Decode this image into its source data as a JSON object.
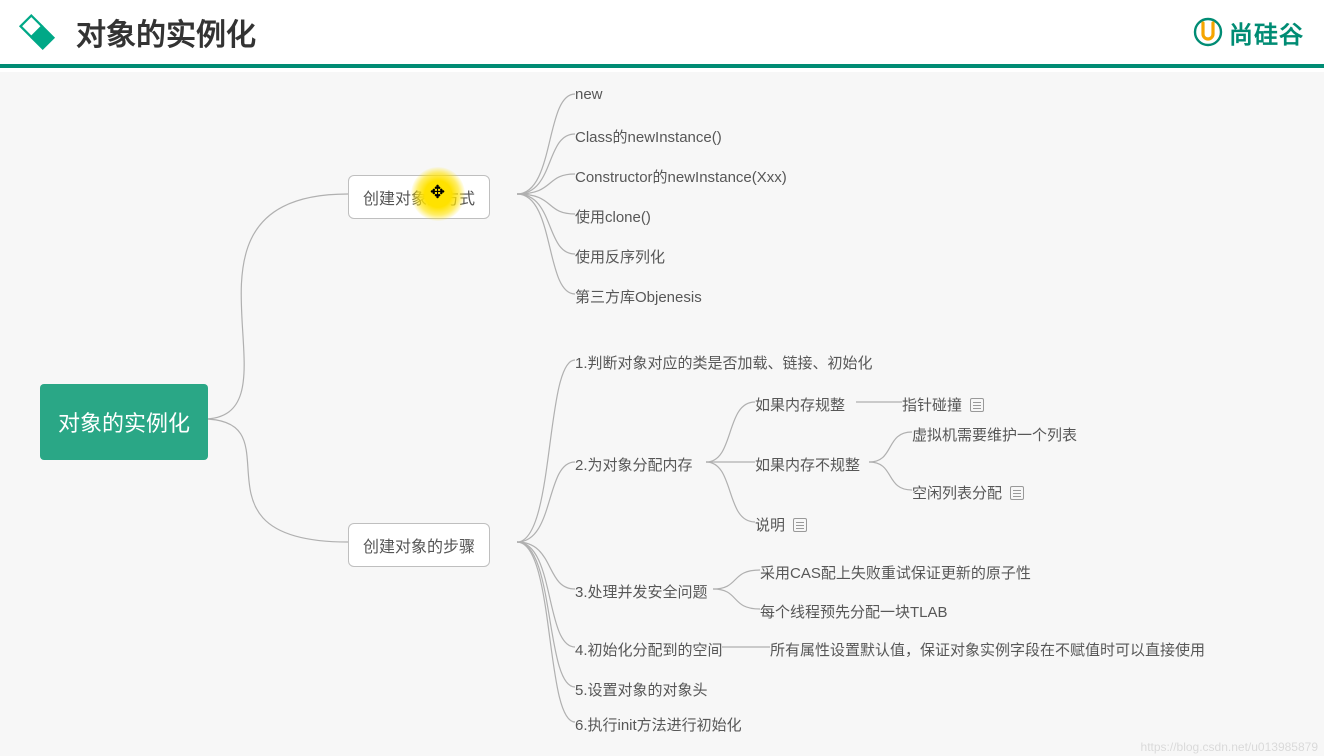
{
  "header": {
    "title": "对象的实例化",
    "brand": "尚硅谷"
  },
  "root": "对象的实例化",
  "branch1": {
    "title": "创建对象的方式",
    "items": [
      "new",
      "Class的newInstance()",
      "Constructor的newInstance(Xxx)",
      "使用clone()",
      "使用反序列化",
      "第三方库Objenesis"
    ]
  },
  "branch2": {
    "title": "创建对象的步骤",
    "step1": "1.判断对象对应的类是否加载、链接、初始化",
    "step2": {
      "label": "2.为对象分配内存",
      "c1": {
        "label": "如果内存规整",
        "tail": "指针碰撞"
      },
      "c2": {
        "label": "如果内存不规整",
        "t1": "虚拟机需要维护一个列表",
        "t2": "空闲列表分配"
      },
      "c3": {
        "label": "说明"
      }
    },
    "step3": {
      "label": "3.处理并发安全问题",
      "t1": "采用CAS配上失败重试保证更新的原子性",
      "t2": "每个线程预先分配一块TLAB"
    },
    "step4": {
      "label": "4.初始化分配到的空间",
      "tail": "所有属性设置默认值，保证对象实例字段在不赋值时可以直接使用"
    },
    "step5": "5.设置对象的对象头",
    "step6": "6.执行init方法进行初始化"
  },
  "watermark": "https://blog.csdn.net/u013985879"
}
